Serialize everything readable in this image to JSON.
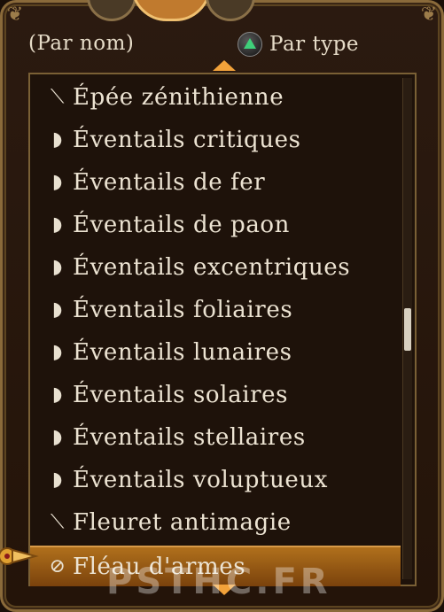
{
  "tabs": {
    "sort_by_name": "(Par nom)",
    "sort_by_type": "Par type"
  },
  "list": [
    {
      "label": "Épée zénithienne",
      "icon": "sword-icon"
    },
    {
      "label": "Éventails critiques",
      "icon": "fan-icon"
    },
    {
      "label": "Éventails de fer",
      "icon": "fan-icon"
    },
    {
      "label": "Éventails de paon",
      "icon": "fan-icon"
    },
    {
      "label": "Éventails excentriques",
      "icon": "fan-icon"
    },
    {
      "label": "Éventails foliaires",
      "icon": "fan-icon"
    },
    {
      "label": "Éventails lunaires",
      "icon": "fan-icon"
    },
    {
      "label": "Éventails solaires",
      "icon": "fan-icon"
    },
    {
      "label": "Éventails stellaires",
      "icon": "fan-icon"
    },
    {
      "label": "Éventails voluptueux",
      "icon": "fan-icon"
    },
    {
      "label": "Fleuret antimagie",
      "icon": "sword-icon"
    },
    {
      "label": "Fléau d'armes",
      "icon": "flail-icon",
      "selected": true
    }
  ],
  "watermark": "PSTHC.FR",
  "colors": {
    "selection": "#b0701c",
    "accent_arrow": "#f2a23a",
    "triangle_button": "#3fd07a"
  }
}
